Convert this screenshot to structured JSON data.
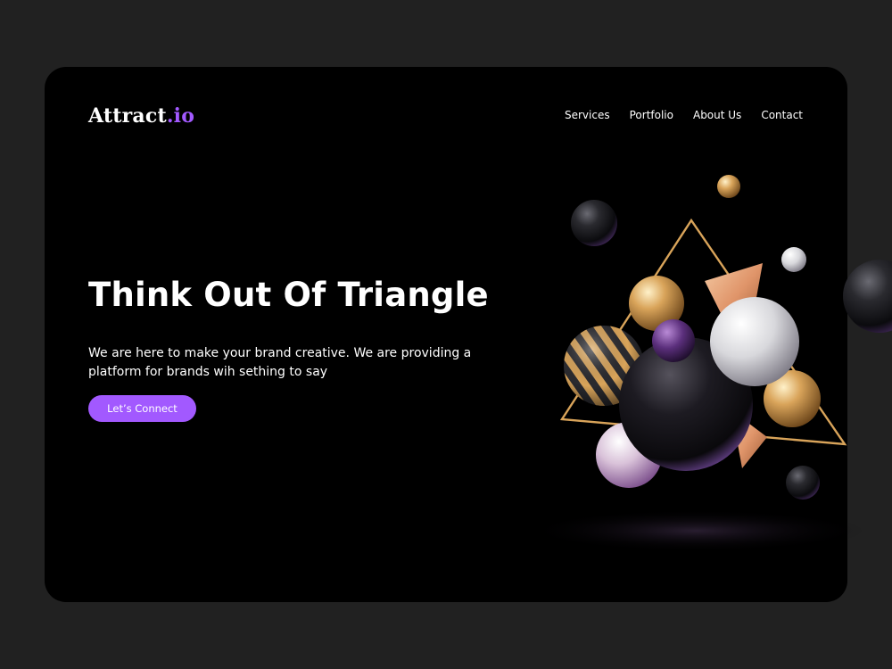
{
  "brand": {
    "name": "Attract",
    "suffix": ".io",
    "accent_color": "#a259ff"
  },
  "nav": {
    "items": [
      "Services",
      "Portfolio",
      "About Us",
      "Contact"
    ]
  },
  "hero": {
    "title": "Think Out Of Triangle",
    "description": "We are here to make your brand creative. We are providing a platform for brands wih sething to say",
    "cta_label": "Let’s Connect"
  },
  "colors": {
    "page_background": "#212121",
    "card_background": "#000000",
    "text": "#ffffff",
    "accent": "#a259ff",
    "gold": "#d9a45a"
  }
}
